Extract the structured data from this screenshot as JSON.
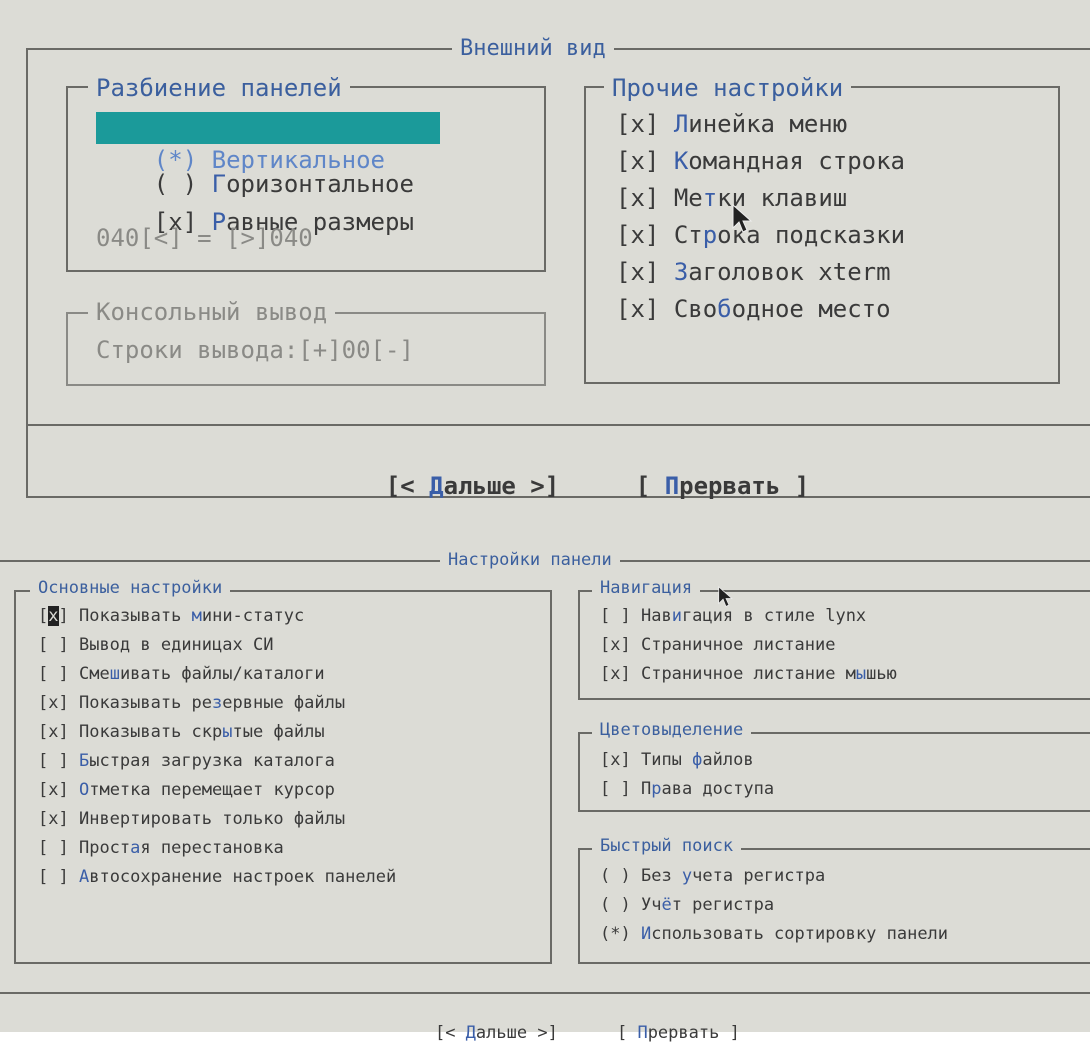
{
  "dialog1": {
    "title": "Внешний вид",
    "panel_split": {
      "title": "Разбиение панелей",
      "vertical": {
        "mark": "(*)",
        "hot": "В",
        "rest": "ертикальное"
      },
      "horizontal": {
        "mark": "( )",
        "hot": "Г",
        "rest": "оризонтальное"
      },
      "equal": {
        "mark": "[x]",
        "hot": "Р",
        "rest": "авные размеры"
      },
      "ratio": "040[<] = [>]040"
    },
    "console": {
      "title": "Консольный вывод",
      "lines": "Строки вывода:[+]00[-]"
    },
    "other": {
      "title": "Прочие настройки",
      "items": [
        {
          "mark": "[x]",
          "pre": "",
          "hot": "Л",
          "rest": "инейка меню"
        },
        {
          "mark": "[x]",
          "pre": "",
          "hot": "К",
          "rest": "омандная строка"
        },
        {
          "mark": "[x]",
          "pre": "Ме",
          "hot": "т",
          "rest": "ки клавиш"
        },
        {
          "mark": "[x]",
          "pre": "Ст",
          "hot": "р",
          "rest": "ока подсказки"
        },
        {
          "mark": "[x]",
          "pre": "",
          "hot": "З",
          "rest": "аголовок xterm"
        },
        {
          "mark": "[x]",
          "pre": "Сво",
          "hot": "б",
          "rest": "одное место"
        }
      ]
    },
    "buttons": {
      "next": {
        "open": "[< ",
        "hot": "Д",
        "rest": "альше >]"
      },
      "abort": {
        "open": "[ ",
        "hot": "П",
        "rest": "рервать ]"
      }
    }
  },
  "dialog2": {
    "title": "Настройки панели",
    "main": {
      "title": "Основные настройки",
      "items": [
        {
          "mark": "[x]",
          "pre": "Показывать ",
          "hot": "м",
          "rest": "ини-статус",
          "cursor": true
        },
        {
          "mark": "[ ]",
          "pre": "Вывод в единицах СИ",
          "hot": "",
          "rest": ""
        },
        {
          "mark": "[ ]",
          "pre": "Сме",
          "hot": "ш",
          "rest": "ивать файлы/каталоги"
        },
        {
          "mark": "[x]",
          "pre": "Показывать ре",
          "hot": "з",
          "rest": "ервные файлы"
        },
        {
          "mark": "[x]",
          "pre": "Показывать скр",
          "hot": "ы",
          "rest": "тые файлы"
        },
        {
          "mark": "[ ]",
          "pre": "",
          "hot": "Б",
          "rest": "ыстрая загрузка каталога"
        },
        {
          "mark": "[x]",
          "pre": "",
          "hot": "О",
          "rest": "тметка перемещает курсор"
        },
        {
          "mark": "[x]",
          "pre": "Инвертировать только файлы",
          "hot": "",
          "rest": ""
        },
        {
          "mark": "[ ]",
          "pre": "Прост",
          "hot": "а",
          "rest": "я перестановка"
        },
        {
          "mark": "[ ]",
          "pre": "",
          "hot": "А",
          "rest": "втосохранение настроек панелей"
        }
      ]
    },
    "navigation": {
      "title": "Навигация",
      "items": [
        {
          "mark": "[ ]",
          "pre": "Нав",
          "hot": "и",
          "rest": "гация в стиле lynx"
        },
        {
          "mark": "[x]",
          "pre": "Страничное листание",
          "hot": "",
          "rest": ""
        },
        {
          "mark": "[x]",
          "pre": "Страничное листание м",
          "hot": "ы",
          "rest": "шью"
        }
      ]
    },
    "colors": {
      "title": "Цветовыделение",
      "items": [
        {
          "mark": "[x]",
          "pre": "Типы ",
          "hot": "ф",
          "rest": "айлов"
        },
        {
          "mark": "[ ]",
          "pre": "П",
          "hot": "р",
          "rest": "ава доступа"
        }
      ]
    },
    "search": {
      "title": "Быстрый поиск",
      "items": [
        {
          "mark": "( )",
          "pre": "Без ",
          "hot": "у",
          "rest": "чета регистра"
        },
        {
          "mark": "( )",
          "pre": "Уч",
          "hot": "ё",
          "rest": "т регистра"
        },
        {
          "mark": "(*)",
          "pre": "",
          "hot": "И",
          "rest": "спользовать сортировку панели"
        }
      ]
    },
    "buttons": {
      "next": {
        "open": "[< ",
        "hot": "Д",
        "rest": "альше >]"
      },
      "abort": {
        "open": "[ ",
        "hot": "П",
        "rest": "рервать ]"
      }
    }
  }
}
